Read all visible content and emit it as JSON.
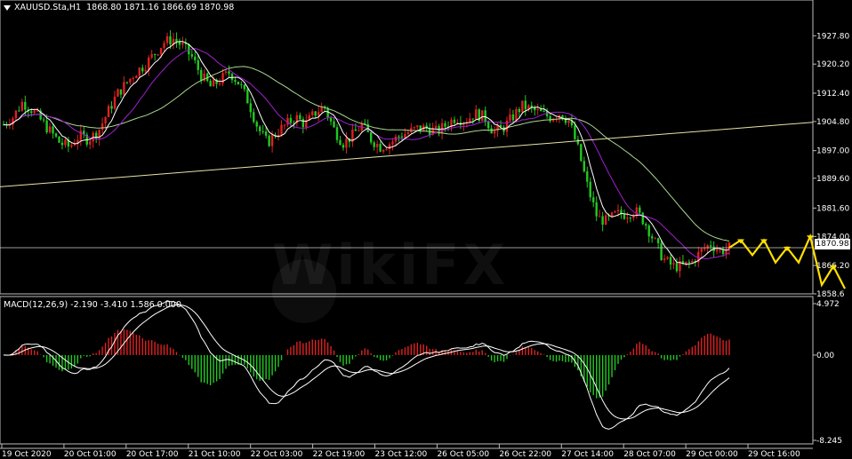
{
  "header": {
    "symbol": "XAUUSD.Sta,H1",
    "ohlc": "1868.80 1871.16 1866.69 1870.98"
  },
  "macd_header": "MACD(12,26,9) -2.190 -3.410 1.586 0.000",
  "current_price": "1870.98",
  "watermark": "WikiFX",
  "colors": {
    "background": "#000000",
    "bull": "#e02020",
    "bear": "#22c922",
    "ma_fast": "#ffffff",
    "ma_mid": "#a020d0",
    "ma_slow": "#a8d890",
    "trendline": "#e8e4a8",
    "forecast": "#ffe000",
    "macd_line": "#ffffff",
    "signal_line": "#ffffff"
  },
  "chart_data": [
    {
      "type": "candlestick",
      "title": "XAUUSD.Sta,H1",
      "ylim": [
        1858.6,
        1935.0
      ],
      "y_ticks": [
        "1927.80",
        "1920.20",
        "1912.40",
        "1904.80",
        "1897.00",
        "1889.60",
        "1881.60",
        "1874.00",
        "1866.20",
        "1858.6"
      ],
      "y_tick_values": [
        1927.8,
        1920.2,
        1912.4,
        1904.8,
        1897.0,
        1889.6,
        1881.6,
        1874.0,
        1866.2,
        1858.6
      ],
      "x_ticks": [
        "19 Oct 2020",
        "20 Oct 01:00",
        "20 Oct 17:00",
        "21 Oct 10:00",
        "22 Oct 03:00",
        "22 Oct 19:00",
        "23 Oct 12:00",
        "26 Oct 05:00",
        "26 Oct 22:00",
        "27 Oct 14:00",
        "28 Oct 07:00",
        "29 Oct 00:00",
        "29 Oct 16:00"
      ],
      "close_path": [
        1904,
        1906,
        1910,
        1908,
        1905,
        1902,
        1899,
        1898,
        1901,
        1900,
        1902,
        1907,
        1912,
        1915,
        1918,
        1920,
        1923,
        1926,
        1927,
        1925,
        1922,
        1917,
        1914,
        1916,
        1918,
        1915,
        1910,
        1903,
        1899,
        1902,
        1904,
        1906,
        1904,
        1907,
        1909,
        1903,
        1899,
        1901,
        1904,
        1900,
        1898,
        1899,
        1901,
        1902,
        1903,
        1903,
        1902,
        1904,
        1906,
        1905,
        1907,
        1906,
        1902,
        1903,
        1906,
        1909,
        1908,
        1907,
        1906,
        1907,
        1905,
        1897,
        1887,
        1879,
        1878,
        1880,
        1880,
        1881,
        1878,
        1873,
        1868,
        1866,
        1866,
        1867,
        1870,
        1872,
        1870,
        1871
      ],
      "trendline": [
        [
          0,
          1887.3
        ],
        [
          1,
          1904.6
        ]
      ],
      "forecast": [
        1870.98,
        1873,
        1869,
        1873,
        1867,
        1871,
        1867,
        1874,
        1861,
        1866,
        1860
      ]
    },
    {
      "type": "macd",
      "title": "MACD(12,26,9)",
      "params": [
        12,
        26,
        9
      ],
      "values": {
        "macd": -2.19,
        "signal": -3.41,
        "histogram": 1.586,
        "zero": 0.0
      },
      "ylim": [
        -8.245,
        4.972
      ],
      "y_ticks": [
        "4.972",
        "0.00",
        "-8.245"
      ],
      "y_tick_values": [
        4.972,
        0.0,
        -8.245
      ]
    }
  ]
}
